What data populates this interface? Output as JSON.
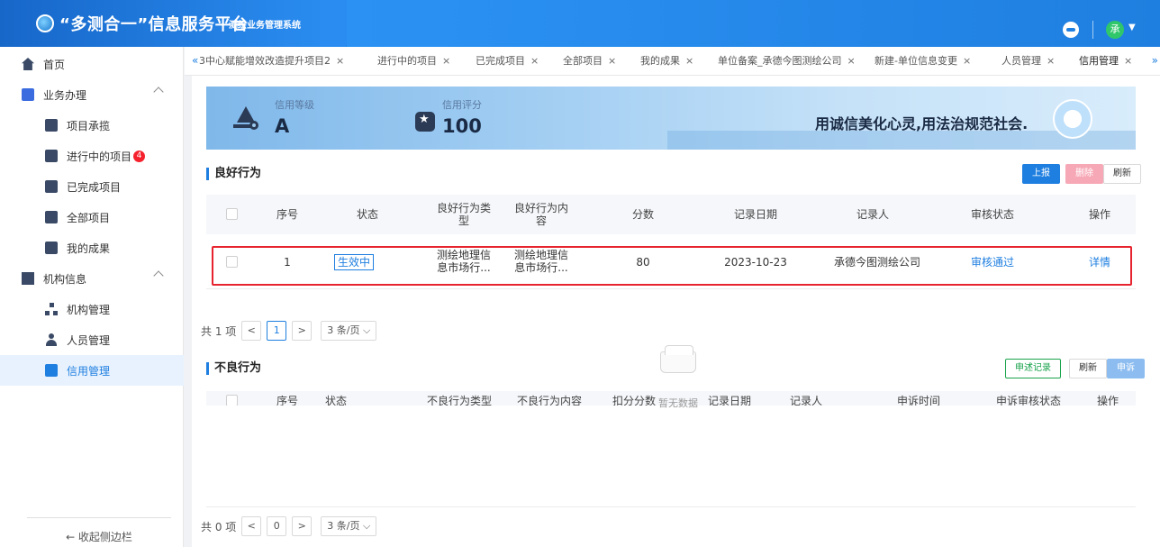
{
  "header": {
    "title": "“多测合一”信息服务平台",
    "subtitle": "测绘业务管理系统",
    "avatar_text": "承",
    "colors": {
      "primary": "#1f7fe0",
      "avatar": "#2fc76a"
    }
  },
  "sidebar": {
    "home": "首页",
    "business": "业务办理",
    "business_items": [
      "项目承揽",
      "进行中的项目",
      "已完成项目",
      "全部项目",
      "我的成果"
    ],
    "in_progress_badge": "4",
    "org": "机构信息",
    "org_items": [
      "机构管理",
      "人员管理",
      "信用管理"
    ],
    "collapse": "← 收起侧边栏"
  },
  "tabs": {
    "items": [
      {
        "label": "3中心赋能增效改造提升项目2"
      },
      {
        "label": "进行中的项目"
      },
      {
        "label": "已完成项目"
      },
      {
        "label": "全部项目"
      },
      {
        "label": "我的成果"
      },
      {
        "label": "单位备案_承德今图测绘公司"
      },
      {
        "label": "新建-单位信息变更"
      },
      {
        "label": "人员管理"
      },
      {
        "label": "信用管理"
      }
    ],
    "close": "×",
    "prev": "«",
    "next": "»"
  },
  "banner": {
    "level_label": "信用等级",
    "level_value": "A",
    "score_label": "信用评分",
    "score_value": "100",
    "slogan": "用诚信美化心灵,用法治规范社会."
  },
  "good": {
    "title": "良好行为",
    "buttons": {
      "report": "上报",
      "delete": "删除",
      "refresh": "刷新"
    },
    "columns": {
      "seq": "序号",
      "status": "状态",
      "type_l1": "良好行为类",
      "type_l2": "型",
      "content_l1": "良好行为内",
      "content_l2": "容",
      "score": "分数",
      "date": "记录日期",
      "recorder": "记录人",
      "audit": "审核状态",
      "op": "操作"
    },
    "rows": [
      {
        "seq": "1",
        "status": "生效中",
        "type_l1": "测绘地理信",
        "type_l2": "息市场行...",
        "content_l1": "测绘地理信",
        "content_l2": "息市场行...",
        "score": "80",
        "date": "2023-10-23",
        "recorder": "承德今图测绘公司",
        "audit": "审核通过",
        "op": "详情"
      }
    ],
    "pager": {
      "total": "共 1 项",
      "page": "1",
      "size": "3 条/页"
    }
  },
  "bad": {
    "title": "不良行为",
    "buttons": {
      "appeal_record": "申述记录",
      "refresh": "刷新",
      "appeal": "申诉"
    },
    "columns": {
      "seq": "序号",
      "status": "状态",
      "type": "不良行为类型",
      "content": "不良行为内容",
      "deduct": "扣分分数",
      "date": "记录日期",
      "recorder": "记录人",
      "appeal_time": "申诉时间",
      "appeal_status": "申诉审核状态",
      "op": "操作"
    },
    "empty": "暂无数据",
    "pager": {
      "total": "共 0 项",
      "page": "0",
      "size": "3 条/页"
    }
  }
}
